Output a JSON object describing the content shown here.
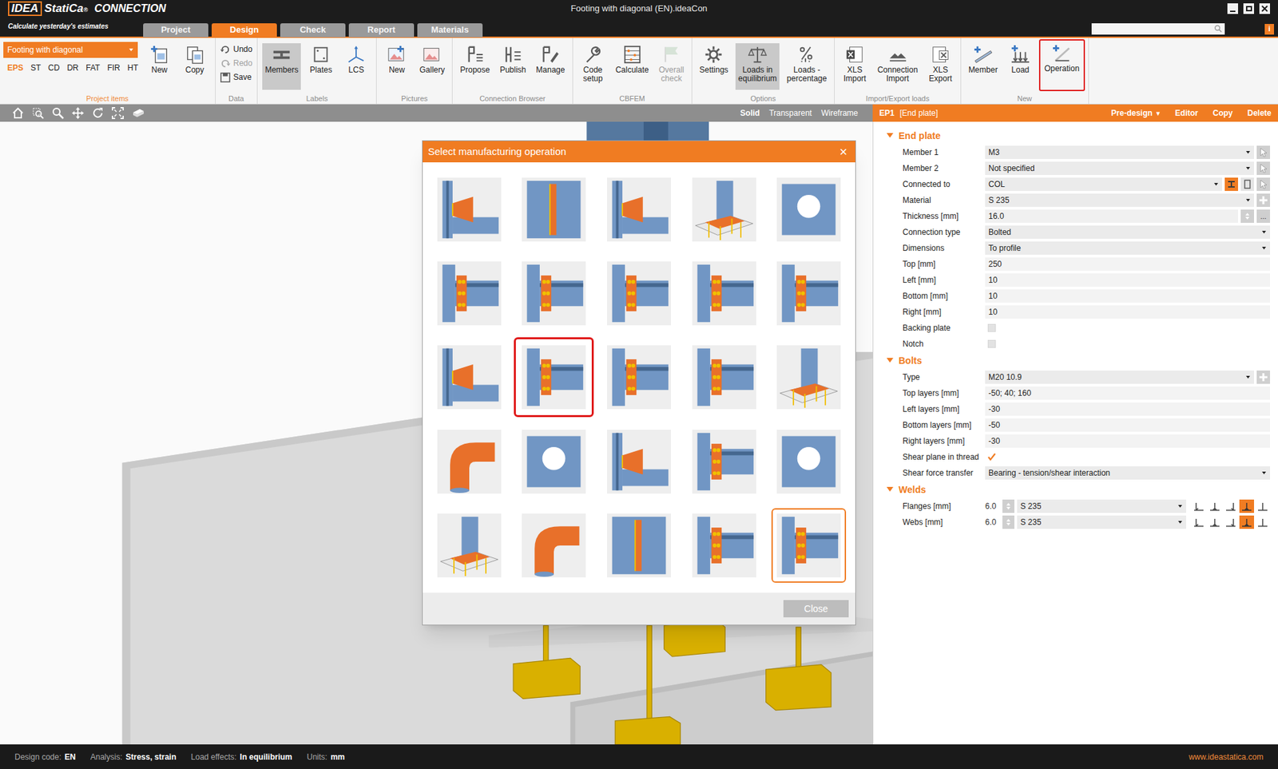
{
  "window": {
    "title": "Footing with diagonal (EN).ideaCon",
    "logo": [
      "IDEA",
      "StatiCa",
      "®"
    ],
    "product": "CONNECTION",
    "tagline": "Calculate yesterday's estimates",
    "info": "i"
  },
  "tabs": [
    {
      "label": "Project",
      "selected": false
    },
    {
      "label": "Design",
      "selected": true
    },
    {
      "label": "Check",
      "selected": false
    },
    {
      "label": "Report",
      "selected": false
    },
    {
      "label": "Materials",
      "selected": false
    }
  ],
  "ribbon": {
    "groups": [
      {
        "label": "Project items",
        "accent": true,
        "dropdown": "Footing with diagonal",
        "codes": [
          {
            "label": "EPS",
            "selected": true
          },
          {
            "label": "ST",
            "selected": false
          },
          {
            "label": "CD",
            "selected": false
          },
          {
            "label": "DR",
            "selected": false
          },
          {
            "label": "FAT",
            "selected": false
          },
          {
            "label": "FIR",
            "selected": false
          },
          {
            "label": "HT",
            "selected": false
          }
        ],
        "buttons": [
          {
            "lines": [
              "New"
            ],
            "kind": "large",
            "selected": false,
            "disabled": false,
            "annotated": false
          },
          {
            "lines": [
              "Copy"
            ],
            "kind": "large",
            "selected": false,
            "disabled": false,
            "annotated": false
          }
        ]
      },
      {
        "label": "Data",
        "accent": false,
        "buttons": [
          {
            "lines": [
              "Undo"
            ],
            "kind": "small",
            "selected": false,
            "disabled": false,
            "annotated": false
          },
          {
            "lines": [
              "Redo"
            ],
            "kind": "small",
            "selected": false,
            "disabled": true,
            "annotated": false
          },
          {
            "lines": [
              "Save"
            ],
            "kind": "small",
            "selected": false,
            "disabled": false,
            "annotated": false
          }
        ]
      },
      {
        "label": "Labels",
        "accent": false,
        "buttons": [
          {
            "lines": [
              "Members"
            ],
            "kind": "large",
            "selected": true,
            "disabled": false,
            "annotated": false
          },
          {
            "lines": [
              "Plates"
            ],
            "kind": "large",
            "selected": false,
            "disabled": false,
            "annotated": false
          },
          {
            "lines": [
              "LCS"
            ],
            "kind": "large",
            "selected": false,
            "disabled": false,
            "annotated": false
          }
        ]
      },
      {
        "label": "Pictures",
        "accent": false,
        "buttons": [
          {
            "lines": [
              "New"
            ],
            "kind": "large",
            "selected": false,
            "disabled": false,
            "annotated": false
          },
          {
            "lines": [
              "Gallery"
            ],
            "kind": "large",
            "selected": false,
            "disabled": false,
            "annotated": false
          }
        ]
      },
      {
        "label": "Connection Browser",
        "accent": false,
        "buttons": [
          {
            "lines": [
              "Propose"
            ],
            "kind": "large",
            "selected": false,
            "disabled": false,
            "annotated": false
          },
          {
            "lines": [
              "Publish"
            ],
            "kind": "large",
            "selected": false,
            "disabled": false,
            "annotated": false
          },
          {
            "lines": [
              "Manage"
            ],
            "kind": "large",
            "selected": false,
            "disabled": false,
            "annotated": false
          }
        ]
      },
      {
        "label": "CBFEM",
        "accent": false,
        "buttons": [
          {
            "lines": [
              "Code",
              "setup"
            ],
            "kind": "large",
            "selected": false,
            "disabled": false,
            "annotated": false
          },
          {
            "lines": [
              "Calculate"
            ],
            "kind": "large",
            "selected": false,
            "disabled": false,
            "annotated": false
          },
          {
            "lines": [
              "Overall",
              "check"
            ],
            "kind": "large",
            "selected": false,
            "disabled": true,
            "annotated": false
          }
        ]
      },
      {
        "label": "Options",
        "accent": false,
        "buttons": [
          {
            "lines": [
              "Settings"
            ],
            "kind": "large",
            "selected": false,
            "disabled": false,
            "annotated": false
          },
          {
            "lines": [
              "Loads in",
              "equilibrium"
            ],
            "kind": "large",
            "selected": true,
            "disabled": false,
            "annotated": false
          },
          {
            "lines": [
              "Loads -",
              "percentage"
            ],
            "kind": "large",
            "selected": false,
            "disabled": false,
            "annotated": false
          }
        ]
      },
      {
        "label": "Import/Export loads",
        "accent": false,
        "buttons": [
          {
            "lines": [
              "XLS",
              "Import"
            ],
            "kind": "large",
            "selected": false,
            "disabled": false,
            "annotated": false
          },
          {
            "lines": [
              "Connection",
              "Import"
            ],
            "kind": "large",
            "selected": false,
            "disabled": false,
            "annotated": false
          },
          {
            "lines": [
              "XLS",
              "Export"
            ],
            "kind": "large",
            "selected": false,
            "disabled": false,
            "annotated": false
          }
        ]
      },
      {
        "label": "New",
        "accent": false,
        "buttons": [
          {
            "lines": [
              "Member"
            ],
            "kind": "large",
            "selected": false,
            "disabled": false,
            "annotated": false
          },
          {
            "lines": [
              "Load"
            ],
            "kind": "large",
            "selected": false,
            "disabled": false,
            "annotated": false
          },
          {
            "lines": [
              "Operation"
            ],
            "kind": "large",
            "selected": false,
            "disabled": false,
            "annotated": true
          }
        ]
      }
    ]
  },
  "view_modes": [
    {
      "label": "Solid",
      "selected": true
    },
    {
      "label": "Transparent",
      "selected": false
    },
    {
      "label": "Wireframe",
      "selected": false
    }
  ],
  "dialog": {
    "title": "Select manufacturing operation",
    "close_glyph": "×",
    "button": "Close",
    "operations": [
      {
        "selected": false,
        "annotated": false
      },
      {
        "selected": false,
        "annotated": false
      },
      {
        "selected": false,
        "annotated": false
      },
      {
        "selected": false,
        "annotated": false
      },
      {
        "selected": false,
        "annotated": false
      },
      {
        "selected": false,
        "annotated": false
      },
      {
        "selected": false,
        "annotated": false
      },
      {
        "selected": false,
        "annotated": false
      },
      {
        "selected": false,
        "annotated": false
      },
      {
        "selected": false,
        "annotated": false
      },
      {
        "selected": false,
        "annotated": false
      },
      {
        "selected": false,
        "annotated": true
      },
      {
        "selected": false,
        "annotated": false
      },
      {
        "selected": false,
        "annotated": false
      },
      {
        "selected": false,
        "annotated": false
      },
      {
        "selected": false,
        "annotated": false
      },
      {
        "selected": false,
        "annotated": false
      },
      {
        "selected": false,
        "annotated": false
      },
      {
        "selected": false,
        "annotated": false
      },
      {
        "selected": false,
        "annotated": false
      },
      {
        "selected": false,
        "annotated": false
      },
      {
        "selected": false,
        "annotated": false
      },
      {
        "selected": false,
        "annotated": false
      },
      {
        "selected": false,
        "annotated": false
      },
      {
        "selected": true,
        "annotated": false
      }
    ]
  },
  "properties": {
    "header": {
      "id": "EP1",
      "type": "[End plate]",
      "actions": [
        {
          "label": "Pre-design",
          "caret": "▾"
        },
        {
          "label": "Editor",
          "caret": ""
        },
        {
          "label": "Copy",
          "caret": ""
        },
        {
          "label": "Delete",
          "caret": ""
        }
      ]
    },
    "sections": [
      {
        "title": "End plate",
        "expanded": true,
        "rows": [
          {
            "label": "Member 1",
            "kind": "picker",
            "value": "M3"
          },
          {
            "label": "Member 2",
            "kind": "picker",
            "value": "Not specified"
          },
          {
            "label": "Connected to",
            "kind": "connected",
            "value": "COL"
          },
          {
            "label": "Material",
            "kind": "selectadd",
            "value": "S 235"
          },
          {
            "label": "Thickness [mm]",
            "kind": "thickness",
            "value": "16.0",
            "extra": "..."
          },
          {
            "label": "Connection type",
            "kind": "select",
            "value": "Bolted"
          },
          {
            "label": "Dimensions",
            "kind": "select",
            "value": "To profile"
          },
          {
            "label": "Top [mm]",
            "kind": "text",
            "value": "250"
          },
          {
            "label": "Left [mm]",
            "kind": "text",
            "value": "10"
          },
          {
            "label": "Bottom [mm]",
            "kind": "text",
            "value": "10"
          },
          {
            "label": "Right [mm]",
            "kind": "text",
            "value": "10"
          },
          {
            "label": "Backing plate",
            "kind": "checkbox",
            "checked": false
          },
          {
            "label": "Notch",
            "kind": "checkbox",
            "checked": false
          }
        ]
      },
      {
        "title": "Bolts",
        "expanded": true,
        "rows": [
          {
            "label": "Type",
            "kind": "selectadd",
            "value": "M20 10.9"
          },
          {
            "label": "Top layers [mm]",
            "kind": "text",
            "value": "-50; 40; 160"
          },
          {
            "label": "Left layers [mm]",
            "kind": "text",
            "value": "-30"
          },
          {
            "label": "Bottom layers [mm]",
            "kind": "text",
            "value": "-50"
          },
          {
            "label": "Right layers [mm]",
            "kind": "text",
            "value": "-30"
          },
          {
            "label": "Shear plane in thread",
            "kind": "checkbox",
            "checked": true
          },
          {
            "label": "Shear force transfer",
            "kind": "select",
            "value": "Bearing - tension/shear interaction"
          }
        ]
      },
      {
        "title": "Welds",
        "expanded": true,
        "rows": [
          {
            "label": "Flanges [mm]",
            "kind": "weld",
            "value": "6.0",
            "material": "S 235",
            "types": [
              {
                "selected": false
              },
              {
                "selected": false
              },
              {
                "selected": false
              },
              {
                "selected": true
              },
              {
                "selected": false
              }
            ]
          },
          {
            "label": "Webs [mm]",
            "kind": "weld",
            "value": "6.0",
            "material": "S 235",
            "types": [
              {
                "selected": false
              },
              {
                "selected": false
              },
              {
                "selected": false
              },
              {
                "selected": true
              },
              {
                "selected": false
              }
            ]
          }
        ]
      }
    ]
  },
  "status_bar": {
    "items": [
      {
        "label": "Design code:",
        "value": "EN"
      },
      {
        "label": "Analysis:",
        "value": "Stress, strain"
      },
      {
        "label": "Load effects:",
        "value": "In equilibrium"
      },
      {
        "label": "Units:",
        "value": "mm"
      }
    ],
    "link": "www.ideastatica.com"
  }
}
